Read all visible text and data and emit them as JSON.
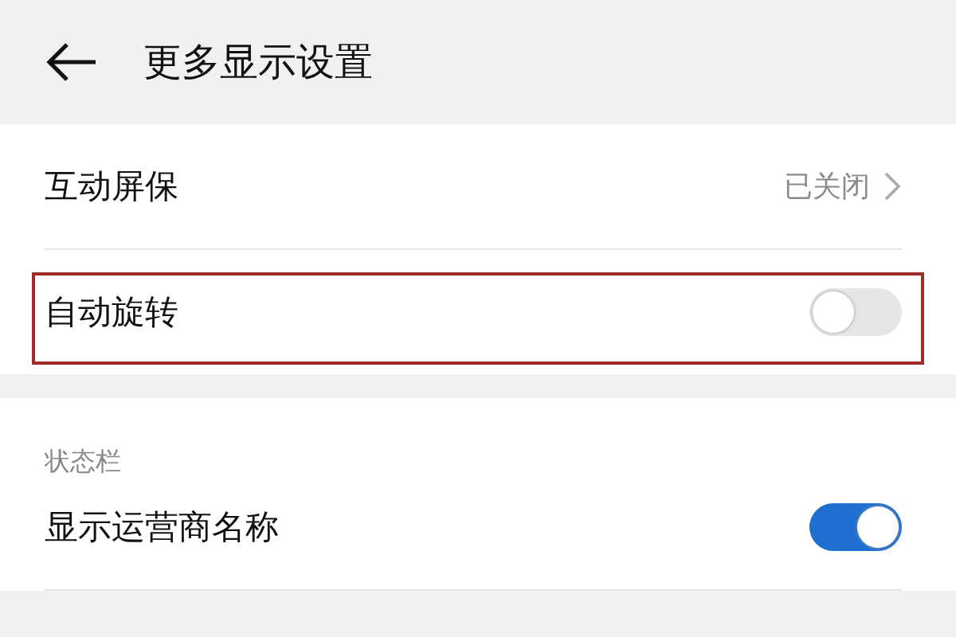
{
  "header": {
    "title": "更多显示设置"
  },
  "groups": [
    {
      "rows": [
        {
          "kind": "link",
          "label": "互动屏保",
          "value": "已关闭",
          "highlighted": false
        },
        {
          "kind": "toggle",
          "label": "自动旋转",
          "on": false,
          "highlighted": true
        }
      ]
    },
    {
      "section_label": "状态栏",
      "rows": [
        {
          "kind": "toggle",
          "label": "显示运营商名称",
          "on": true,
          "highlighted": false
        }
      ]
    }
  ]
}
